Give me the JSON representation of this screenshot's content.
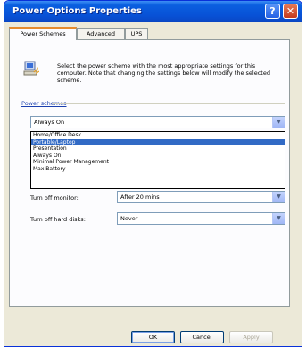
{
  "window": {
    "title": "Power Options Properties"
  },
  "titlebar": {
    "help_label": "?",
    "close_label": "✕"
  },
  "tabs": [
    {
      "label": "Power Schemes"
    },
    {
      "label": "Advanced"
    },
    {
      "label": "UPS"
    }
  ],
  "description": "Select the power scheme with the most appropriate settings for this computer. Note that changing the settings below will modify the selected scheme.",
  "power_schemes": {
    "group_label": "Power schemes",
    "selected": "Always On",
    "options": [
      "Home/Office Desk",
      "Portable/Laptop",
      "Presentation",
      "Always On",
      "Minimal Power Management",
      "Max Battery"
    ],
    "highlighted_index": 1
  },
  "settings": {
    "monitor_label": "Turn off monitor:",
    "monitor_value": "After 20 mins",
    "hard_disks_label": "Turn off hard disks:",
    "hard_disks_value": "Never"
  },
  "buttons": {
    "ok": "OK",
    "cancel": "Cancel",
    "apply": "Apply"
  },
  "colors": {
    "titlebar": "#0851d6",
    "highlight": "#316ac5",
    "dialog_bg": "#ece9d8"
  }
}
